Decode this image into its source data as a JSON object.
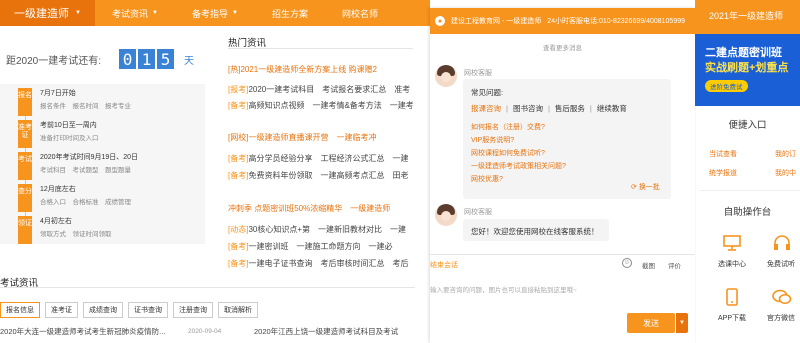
{
  "nav": {
    "brand": "一级建造师",
    "items": [
      "考试资讯",
      "备考指导",
      "招生方案",
      "网校名师"
    ]
  },
  "countdown": {
    "label": "距2020一建考试还有:",
    "digits": [
      "0",
      "1",
      "5"
    ],
    "unit": "天"
  },
  "timeline": [
    {
      "badge": "报名",
      "title": "7月7日开始",
      "sub": "报名条件　报名时间　报考专业"
    },
    {
      "badge": "准考证",
      "title": "考前10日至一周内",
      "sub": "准备打印时间及入口"
    },
    {
      "badge": "考试",
      "title": "2020年考试时间9月19日、20日",
      "sub": "考试科目　考试题型　题型题量"
    },
    {
      "badge": "查分",
      "title": "12月底左右",
      "sub": "合格入口　合格标准　成绩管理"
    },
    {
      "badge": "领证",
      "title": "4月初左右",
      "sub": "领取方式　领证时间领取"
    }
  ],
  "news": {
    "title": "热门资讯",
    "items": [
      {
        "kind": "headline",
        "tag": "[热]",
        "text": "2021一级建造师全新方案上线 购课赠2"
      },
      {
        "kind": "normal",
        "tag": "[报考]",
        "text": "2020一建考试科目　考试报名要求汇总　准考"
      },
      {
        "kind": "normal",
        "tag": "[备考]",
        "text": "高频知识点视频　一建考情&备考方法　一建考"
      },
      {
        "kind": "headline",
        "tag": "[网校]",
        "text": "一级建造师直播课开营　一建临考冲"
      },
      {
        "kind": "normal",
        "tag": "[备考]",
        "text": "高分学员经验分享　工程经济公式汇总　一建"
      },
      {
        "kind": "normal",
        "tag": "[备考]",
        "text": "免费资料年份领取　一建高频考点汇总　田老"
      },
      {
        "kind": "headline",
        "tag": "",
        "text": "冲刺季 点题密训班50%浓缩精华　一级建造师"
      },
      {
        "kind": "normal",
        "tag": "[动态]",
        "text": "30核心知识点+第　一建新旧教材对比　一建"
      },
      {
        "kind": "normal",
        "tag": "[备考]",
        "text": "一建密训班　一建施工命题方向　一建必"
      },
      {
        "kind": "normal",
        "tag": "[备考]",
        "text": "一建电子证书查询　考后审核时间汇总　考后"
      }
    ]
  },
  "exam_news": {
    "title": "考试资讯",
    "tabs": [
      "报名信息",
      "准考证",
      "成绩查询",
      "证书查询",
      "注册查询",
      "取消解析"
    ],
    "rows": [
      {
        "text": "2020年大连一级建造师考试考生新冠肺炎疫情防...",
        "date": "2020-09-04"
      },
      {
        "text": "2020年江西上饶一级建造师考试科目及考试"
      }
    ]
  },
  "chat": {
    "title": "建设工程教育网 - 一级建造师",
    "hotline": "24小时客服电话:010-82326699/4008105999",
    "more_messages": "查看更多消息",
    "agent_name": "网校客服",
    "faq_title": "常见问题:",
    "faq_links": [
      "报课咨询",
      "图书咨询",
      "售后服务",
      "继续教育"
    ],
    "faq_items": [
      "如何报名（注册）交费?",
      "VIP服务说明?",
      "网校课程如何免费试听?",
      "一级建造师考试政策相关问题?",
      "网校优惠?"
    ],
    "refresh_label": "换一批",
    "welcome": "您好！欢迎您使用网校在线客服系统！",
    "end_chat": "结束会话",
    "tool_screenshot": "截图",
    "tool_evaluate": "评价",
    "input_placeholder": "输入要咨询的问题，图片也可以直接粘贴到这里哦~",
    "send": "发送"
  },
  "sidebar": {
    "header_title": "2021年一级建造师",
    "banner_line1": "二建点题密训班",
    "banner_line2": "实战刷题+划重点",
    "banner_button": "进阶免费试",
    "quick_entry_title": "便捷入口",
    "quick_links": [
      "当试查看",
      "我的订",
      "统学报道",
      "我的中"
    ],
    "self_service_title": "自助操作台",
    "self_service": [
      "选课中心",
      "免费试听",
      "APP下载",
      "官方微信"
    ]
  }
}
